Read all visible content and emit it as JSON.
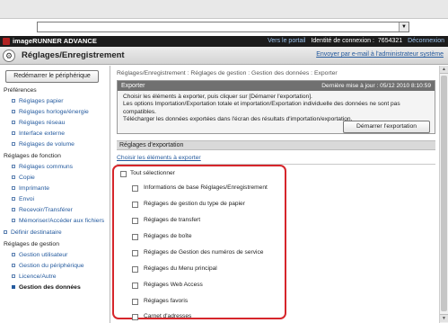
{
  "header": {
    "brand": "imageRUNNER ADVANCE",
    "portal_link": "Vers le portail",
    "login_label": "Identité de connexion :",
    "login_id": "7654321",
    "logout": "Déconnexion"
  },
  "titlebar": {
    "title": "Réglages/Enregistrement",
    "email_link": "Envoyer par e-mail à l'administrateur système"
  },
  "sidebar": {
    "restart_button": "Redémarrer le périphérique",
    "preferences": "Préférences",
    "pref_items": [
      "Réglages papier",
      "Réglages horloge/énergie",
      "Réglages réseau",
      "Interface externe",
      "Réglages de volume"
    ],
    "function_settings": "Réglages de fonction",
    "function_items": [
      "Réglages communs",
      "Copie",
      "Imprimante",
      "Envoi",
      "Recevoir/Transférer",
      "Mémoriser/Accéder aux fichiers"
    ],
    "destination": "Définir destinataire",
    "management": "Réglages de gestion",
    "management_items": [
      "Gestion utilisateur",
      "Gestion du périphérique",
      "Licence/Autre",
      "Gestion des données"
    ]
  },
  "breadcrumb": {
    "items": [
      "Réglages/Enregistrement",
      "Réglages de gestion",
      "Gestion des données",
      "Exporter"
    ],
    "separator": ":"
  },
  "export_panel": {
    "title": "Exporter",
    "last_update_label": "Dernière mise à jour :",
    "last_update_value": "05/12 2010 8:10:59",
    "description": [
      "Choisir les éléments à exporter, puis cliquer sur [Démarrer l'exportation].",
      "Les options Importation/Exportation totale et importation/Exportation individuelle des données ne sont pas compatibles.",
      "Télécharger les données exportées dans l'écran des résultats d'importation/exportation."
    ],
    "start_button": "Démarrer l'exportation"
  },
  "export_settings": {
    "section_title": "Réglages d'exportation",
    "choose_label": "Choisir les éléments à exporter",
    "select_all": "Tout sélectionner",
    "options": [
      "Informations de base Réglages/Enregistrement",
      "Réglages de gestion du type de papier",
      "Réglages de transfert",
      "Réglages de boîte",
      "Réglages de Gestion des numéros de service",
      "Réglages du Menu principal",
      "Réglages Web Access",
      "Réglages favoris",
      "Carnet d'adresses"
    ]
  },
  "colors": {
    "highlight_border": "#d6262b",
    "link": "#245a9e",
    "top_bar": "#1c1c1c"
  }
}
